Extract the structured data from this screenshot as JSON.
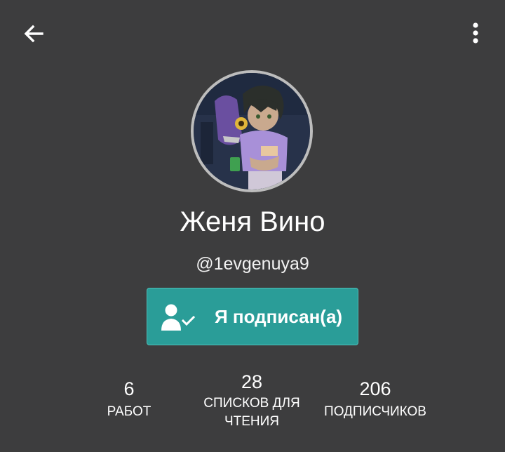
{
  "header": {
    "back_icon": "arrow-left-icon",
    "more_icon": "more-vertical-icon"
  },
  "profile": {
    "name": "Женя Вино",
    "handle": "@1evgenuya9",
    "avatar": "profile-avatar"
  },
  "follow_button": {
    "label": "Я подписан(а)",
    "icon": "user-check-icon",
    "color": "#2a9d98"
  },
  "stats": {
    "works": {
      "value": "6",
      "label": "РАБОТ"
    },
    "reading_lists": {
      "value": "28",
      "label_line1": "СПИСКОВ ДЛЯ",
      "label_line2": "ЧТЕНИЯ"
    },
    "followers": {
      "value": "206",
      "label": "ПОДПИСЧИКОВ"
    }
  },
  "colors": {
    "background": "#3d3d3e",
    "accent": "#2a9d98",
    "avatar_border": "#bdbdbd"
  }
}
